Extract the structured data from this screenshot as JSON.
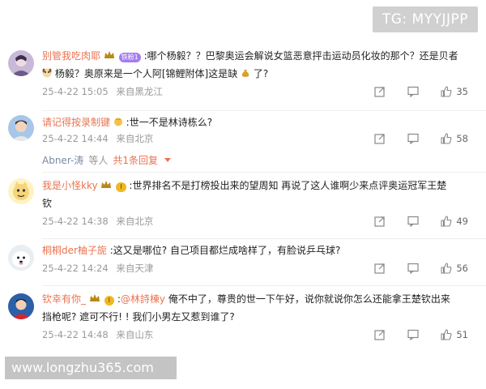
{
  "watermark_top": "TG: MYYJJPP",
  "watermark_bottom": "www.longzhu365.com",
  "comments": [
    {
      "username": "别管我吃肉耶",
      "fan_badge": "铁粉1",
      "text_line1": ":哪个杨毅？？巴黎奥运会解说女篮恶意抨击运动员化妆的那个？还是贝者",
      "text_line2_a": "杨毅？奥原来是一个人阿[锦鲤附体]这是缺",
      "text_line2_b": "了?",
      "date": "25-4-22 15:05",
      "location": "来自黑龙江",
      "likes": "35"
    },
    {
      "username": "请记得按录制键",
      "text_line1": ":世一不是林诗栋么?",
      "date": "25-4-22 14:44",
      "location": "来自北京",
      "likes": "58",
      "reply_user": "Abner-涛",
      "reply_suffix": "等人",
      "reply_count": "共1条回复"
    },
    {
      "username": "我是小怪kky",
      "level_badge": "I",
      "text_line1": ":世界排名不是打榜投出来的望周知 再说了这人谁啊少来点评奥运冠军王楚",
      "text_line2": "钦",
      "date": "25-4-22 14:38",
      "location": "来自北京",
      "likes": "49"
    },
    {
      "username": "桐桐der柚子旎",
      "text_line1": ":这又是哪位? 自己项目都烂成啥样了，有脸说乒乓球?",
      "date": "25-4-22 14:24",
      "location": "来自天津",
      "likes": "56"
    },
    {
      "username": "钦幸有你_",
      "level_badge": "I",
      "mention": "@林詩棟y",
      "text_line1_prefix": ":",
      "text_line1_suffix": " 俺不中了，尊贵的世一下午好，说你就说你怎么还能拿王楚钦出来",
      "text_line2": "挡枪呢? 遮可不行! ! 我们小男左又惹到谁了?",
      "date": "25-4-22 14:48",
      "location": "来自山东",
      "likes": "51"
    }
  ],
  "icons": {
    "share": "share-icon",
    "comment": "comment-icon",
    "like": "thumbs-up-icon"
  },
  "colors": {
    "username": "#eb7350",
    "meta": "#999999",
    "fan_badge": "#a57cf0",
    "level_badge": "#f0b722"
  }
}
